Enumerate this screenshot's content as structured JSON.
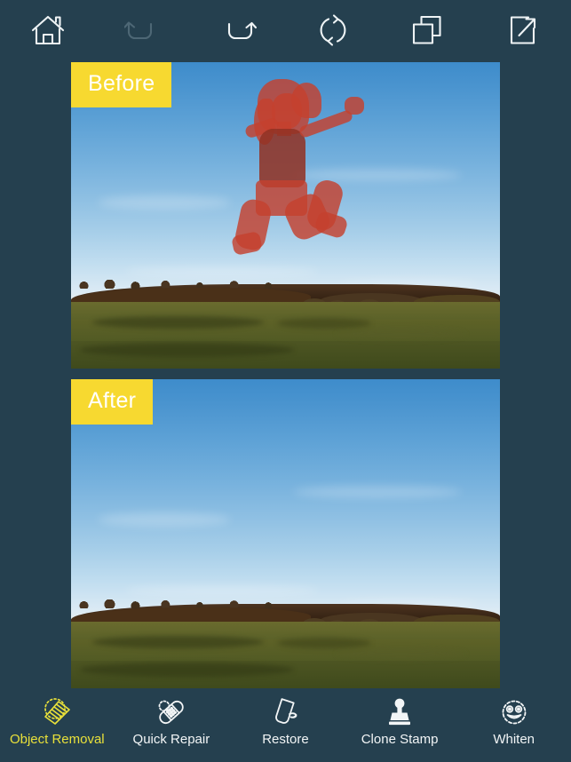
{
  "app": {
    "background_color": "#25404f",
    "accent_color": "#e8e03a",
    "badge_color": "#f7d930"
  },
  "top_toolbar": {
    "items": [
      {
        "name": "home",
        "icon": "home-icon",
        "label": "Home",
        "enabled": true
      },
      {
        "name": "undo",
        "icon": "undo-icon",
        "label": "Undo",
        "enabled": false
      },
      {
        "name": "redo",
        "icon": "redo-icon",
        "label": "Redo",
        "enabled": true
      },
      {
        "name": "reset",
        "icon": "refresh-icon",
        "label": "Reset",
        "enabled": true
      },
      {
        "name": "compare",
        "icon": "layers-icon",
        "label": "Compare",
        "enabled": true
      },
      {
        "name": "share",
        "icon": "share-icon",
        "label": "Share",
        "enabled": true
      }
    ]
  },
  "canvas": {
    "before": {
      "badge": "Before",
      "alt": "Woman jumping in the air over a golf course at sunset, with the figure highlighted by a red selection mask",
      "selection_mask_color": "#c5412e",
      "has_selection": true
    },
    "after": {
      "badge": "After",
      "alt": "The same golf course landscape at sunset with the jumping woman removed",
      "has_selection": false
    }
  },
  "bottom_toolbar": {
    "items": [
      {
        "name": "object-removal",
        "icon": "eraser-icon",
        "label": "Object Removal",
        "active": true
      },
      {
        "name": "quick-repair",
        "icon": "bandage-icon",
        "label": "Quick Repair",
        "active": false
      },
      {
        "name": "restore",
        "icon": "brush-icon",
        "label": "Restore",
        "active": false
      },
      {
        "name": "clone-stamp",
        "icon": "clone-stamp-icon",
        "label": "Clone Stamp",
        "active": false
      },
      {
        "name": "whiten",
        "icon": "smiley-icon",
        "label": "Whiten",
        "active": false
      }
    ]
  }
}
